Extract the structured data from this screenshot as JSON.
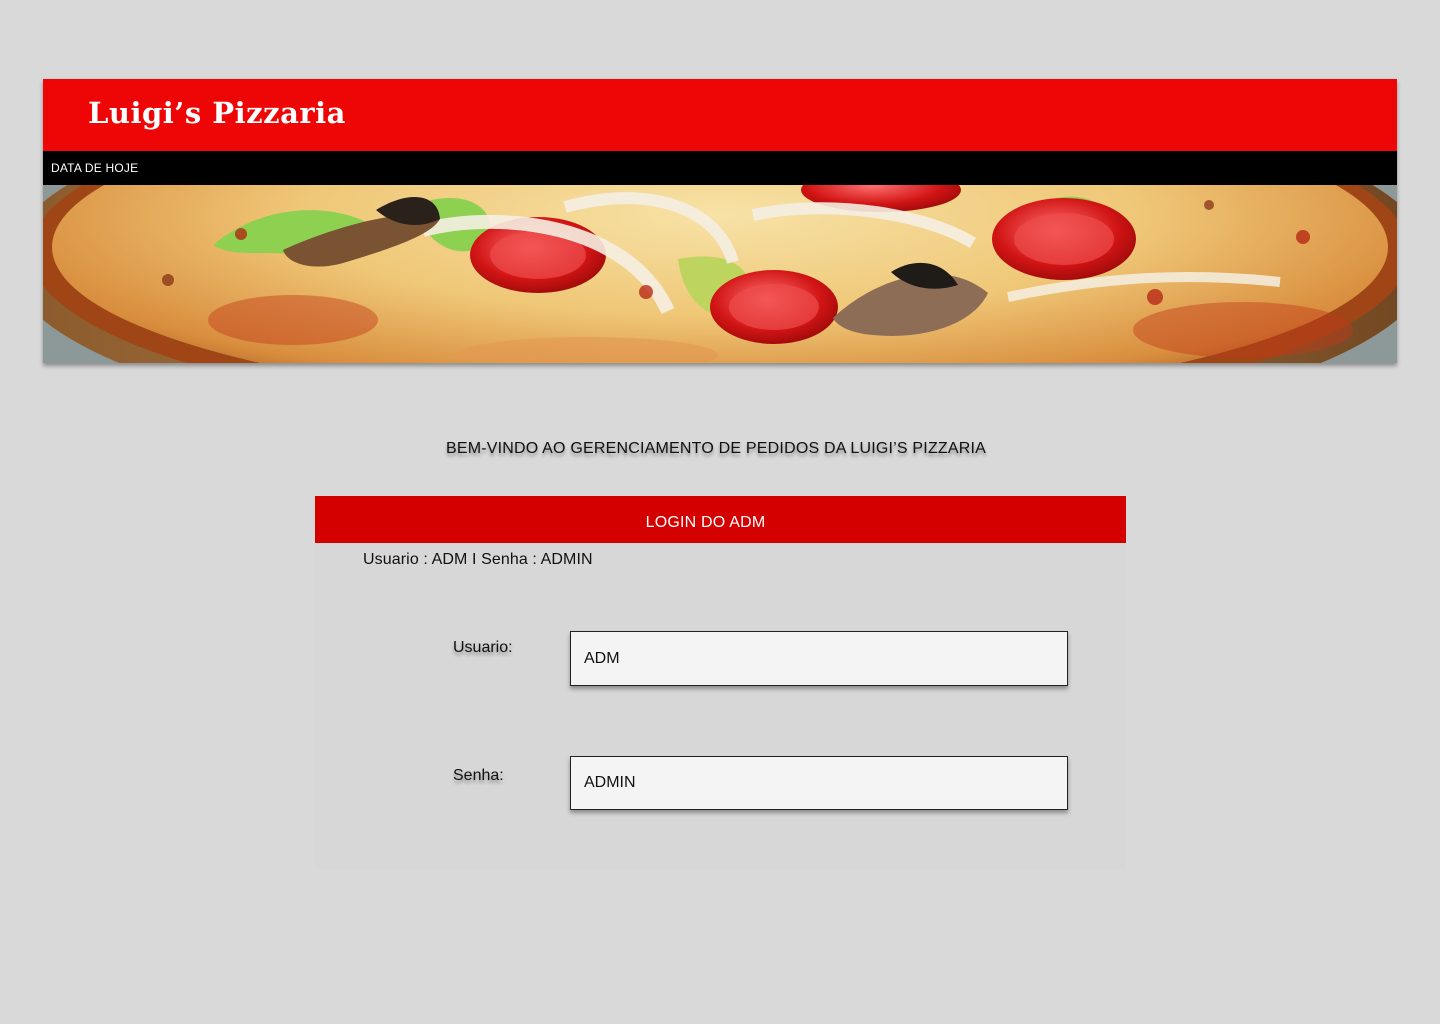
{
  "header": {
    "brand_title": "Luigi’s Pizzaria",
    "date_label": "DATA DE HOJE",
    "banner_icon": "pizza-photo",
    "accent_color": "#ee0505"
  },
  "main": {
    "welcome_text": "BEM-VINDO AO GERENCIAMENTO DE PEDIDOS DA LUIGI’S PIZZARIA"
  },
  "login": {
    "title": "LOGIN DO ADM",
    "credentials_hint": "Usuario : ADM I Senha : ADMIN",
    "header_color": "#d40000",
    "username": {
      "label": "Usuario:",
      "value": "ADM"
    },
    "password": {
      "label": "Senha:",
      "value": "ADMIN"
    }
  }
}
